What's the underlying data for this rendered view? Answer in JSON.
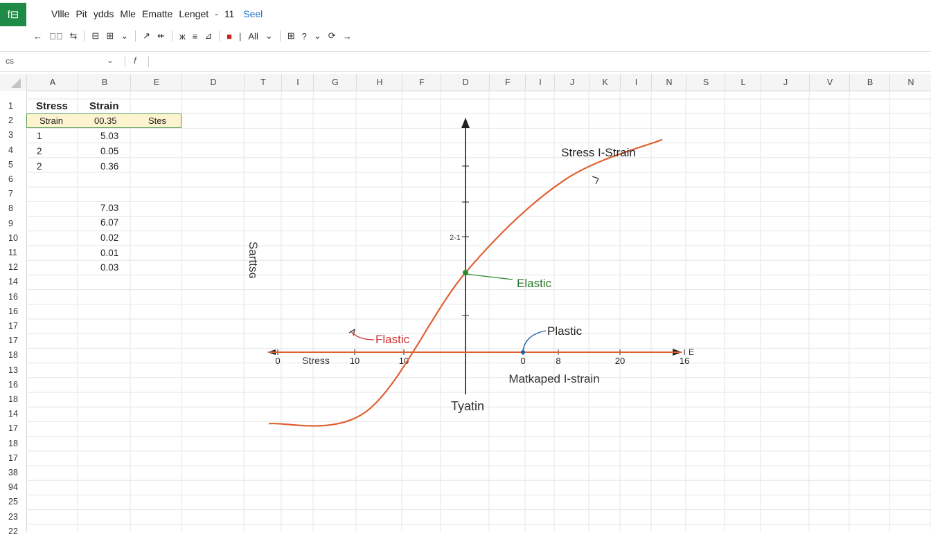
{
  "app": {
    "logo": "f⊟"
  },
  "menu": [
    {
      "label": "Vllle"
    },
    {
      "label": "Pit"
    },
    {
      "label": "ydds"
    },
    {
      "label": "Mle"
    },
    {
      "label": "Ematte"
    },
    {
      "label": "Lenget"
    },
    {
      "label": "11",
      "extra": "Seel"
    }
  ],
  "menu_dash": "-",
  "toolbar": {
    "items": [
      "←",
      "◁⃦",
      "⇆",
      "⊟",
      "⊞",
      "⌄",
      "↗",
      "⇷",
      "ж",
      "≡",
      "⊿",
      "Ali",
      "⌄",
      "⊞",
      "?",
      "⌄",
      "⟳",
      "→"
    ],
    "fill_color_hex": "#cc2222",
    "all_label": "All"
  },
  "formula_bar": {
    "name_box": "cs",
    "dropdown": "⌄",
    "fx": "f"
  },
  "columns": [
    "A",
    "B",
    "E",
    "D",
    "T",
    "I",
    "G",
    "H",
    "F",
    "D",
    "F",
    "I",
    "J",
    "K",
    "I",
    "N",
    "S",
    "L",
    "J",
    "V",
    "B",
    "N"
  ],
  "rows": [
    "1",
    "2",
    "3",
    "4",
    "5",
    "6",
    "7",
    "8",
    "9",
    "10",
    "11",
    "12",
    "14",
    "16",
    "16",
    "17",
    "17",
    "18",
    "13",
    "16",
    "18",
    "14",
    "17",
    "18",
    "17",
    "38",
    "94",
    "25",
    "23",
    "22"
  ],
  "cells": {
    "a1": "Stress",
    "b1": "Strain",
    "a2": "Strain",
    "b2": "00.35",
    "c2": "Stes",
    "a3": "1",
    "b3": "5.03",
    "a4": "2",
    "b4": "0.05",
    "a5": "2",
    "b5": "0.36",
    "b8": "7.03",
    "b9": "6.07",
    "b10": "0.02",
    "b11": "0.01",
    "b12": "0.03"
  },
  "chart_data": {
    "type": "line",
    "series": [
      {
        "name": "Stress I-Strain",
        "x": [
          -20,
          -10,
          0,
          10,
          20
        ],
        "y": [
          -4.5,
          -4.0,
          1.4,
          5.0,
          6.6
        ]
      },
      {
        "values": "baseline",
        "x": [
          -20,
          22
        ],
        "y": [
          -4.5,
          -4.5
        ]
      }
    ],
    "axis_ticks_x": [
      "0",
      "10",
      "10",
      "0",
      "8",
      "20",
      "16"
    ],
    "x_axis_text": "Stress",
    "x_axis_end_label": "E",
    "y_tick_label": "2-1",
    "ylabel": "Sarttsɢ",
    "xlabel": "Tyatin",
    "subtitle": "Matkaped I-strain",
    "annotations": [
      {
        "text": "Stress I-Strain",
        "color": "#222222"
      },
      {
        "text": "Elastic",
        "color": "#2a7a2a"
      },
      {
        "text": "Flastic",
        "color": "#cc3333"
      },
      {
        "text": "Plastic",
        "color": "#222222"
      }
    ],
    "line_color": "#e06030",
    "grid": true
  }
}
